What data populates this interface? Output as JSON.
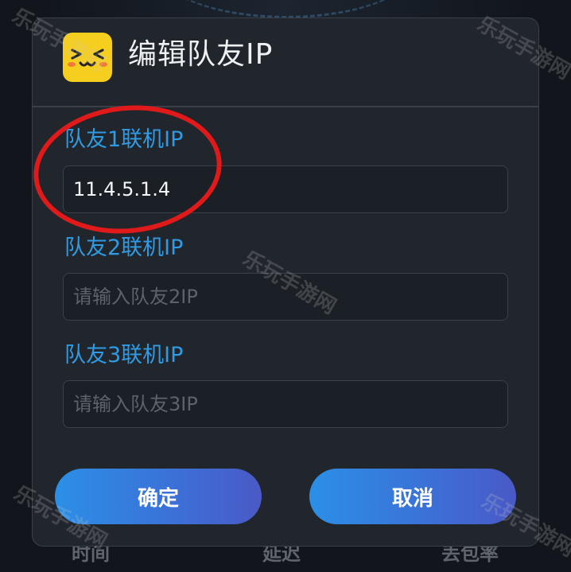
{
  "background": {
    "bottom_tabs": [
      "时间",
      "延迟",
      "丢包率"
    ]
  },
  "dialog": {
    "icon": "kaomoji-face-icon",
    "title": "编辑队友IP",
    "fields": [
      {
        "label": "队友1联机IP",
        "value": "11.4.5.1.4",
        "placeholder": ""
      },
      {
        "label": "队友2联机IP",
        "value": "",
        "placeholder": "请输入队友2IP"
      },
      {
        "label": "队友3联机IP",
        "value": "",
        "placeholder": "请输入队友3IP"
      }
    ],
    "confirm_label": "确定",
    "cancel_label": "取消"
  },
  "annotation": {
    "color": "#e01a1a",
    "shape": "ellipse"
  },
  "watermark": "乐玩手游网",
  "colors": {
    "accent": "#2f9be4",
    "button_gradient": [
      "#2b8fe6",
      "#4a59c6"
    ],
    "dialog_bg": "#21252c",
    "icon_bg": "#f6cf1e"
  }
}
